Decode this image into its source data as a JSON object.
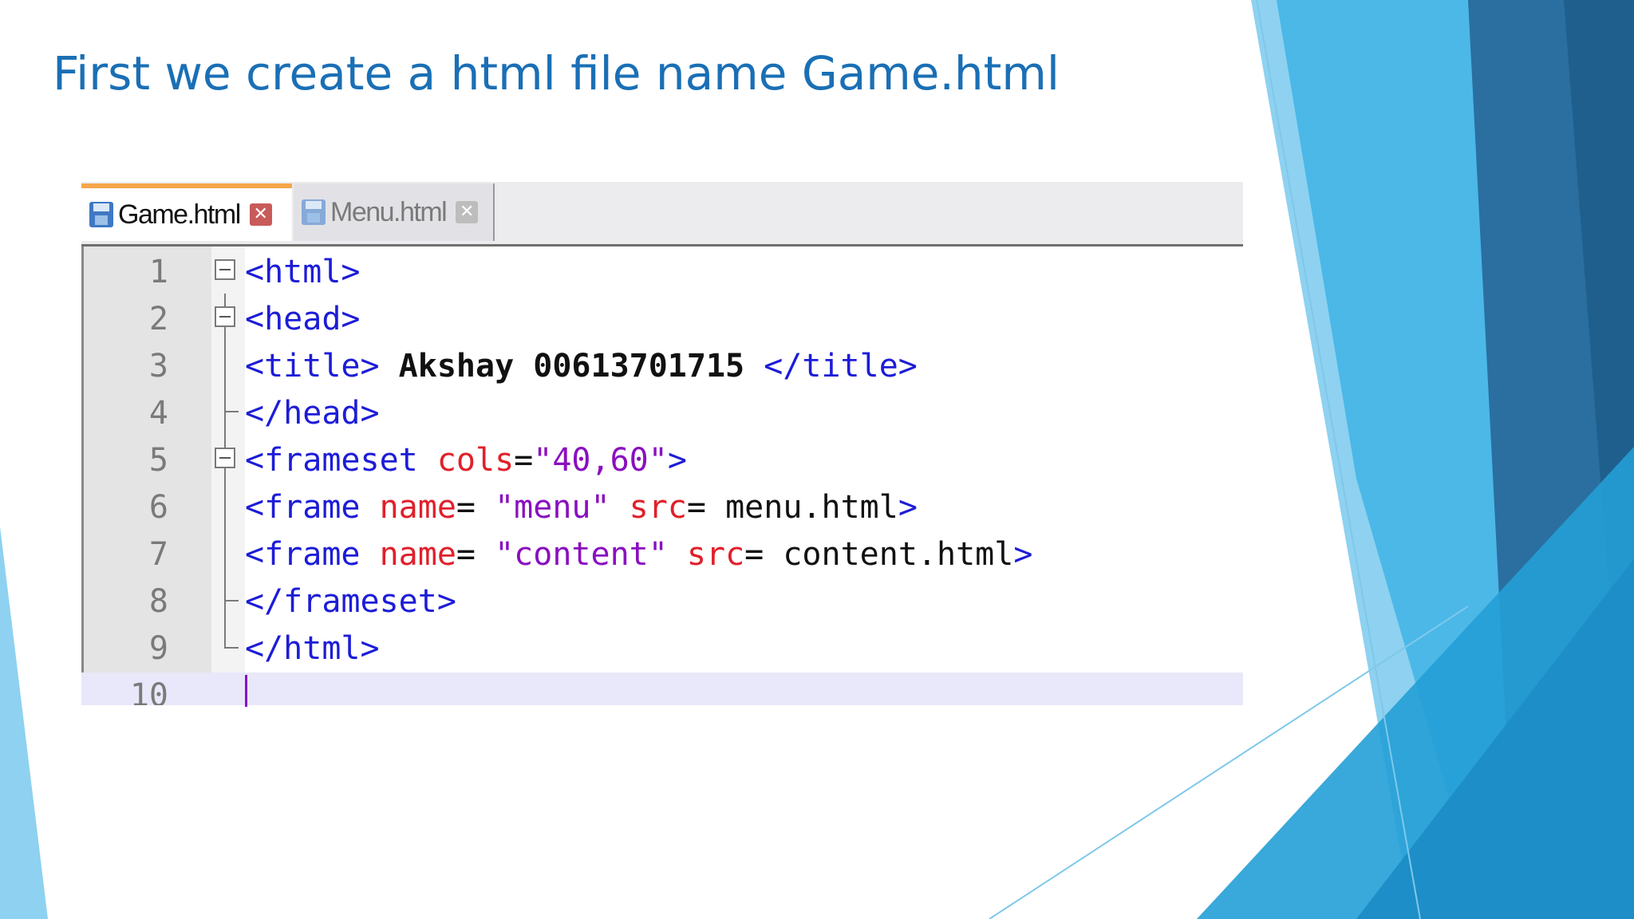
{
  "slide": {
    "title": "First we create a html file name Game.html"
  },
  "tabs": [
    {
      "label": "Game.html",
      "active": true,
      "icon": "save-icon",
      "close_icon": "close-icon"
    },
    {
      "label": "Menu.html",
      "active": false,
      "icon": "save-icon",
      "close_icon": "close-icon"
    }
  ],
  "editor": {
    "current_line": 10,
    "line_numbers": [
      "1",
      "2",
      "3",
      "4",
      "5",
      "6",
      "7",
      "8",
      "9",
      "10"
    ],
    "lines": [
      [
        {
          "t": "<html>",
          "k": "tag"
        }
      ],
      [
        {
          "t": "<head>",
          "k": "tag"
        }
      ],
      [
        {
          "t": "<title>",
          "k": "tag"
        },
        {
          "t": " Akshay 00613701715 ",
          "k": "txt-bold"
        },
        {
          "t": "</title>",
          "k": "tag"
        }
      ],
      [
        {
          "t": "</head>",
          "k": "tag"
        }
      ],
      [
        {
          "t": "<frameset ",
          "k": "tag"
        },
        {
          "t": "cols",
          "k": "attr"
        },
        {
          "t": "=",
          "k": "txt"
        },
        {
          "t": "\"40,60\"",
          "k": "str"
        },
        {
          "t": ">",
          "k": "tag"
        }
      ],
      [
        {
          "t": "<frame ",
          "k": "tag"
        },
        {
          "t": "name",
          "k": "attr"
        },
        {
          "t": "= ",
          "k": "txt"
        },
        {
          "t": "\"menu\"",
          "k": "str"
        },
        {
          "t": " ",
          "k": "txt"
        },
        {
          "t": "src",
          "k": "attr"
        },
        {
          "t": "= menu.html",
          "k": "txt"
        },
        {
          "t": ">",
          "k": "tag"
        }
      ],
      [
        {
          "t": "<frame ",
          "k": "tag"
        },
        {
          "t": "name",
          "k": "attr"
        },
        {
          "t": "= ",
          "k": "txt"
        },
        {
          "t": "\"content\"",
          "k": "str"
        },
        {
          "t": " ",
          "k": "txt"
        },
        {
          "t": "src",
          "k": "attr"
        },
        {
          "t": "= content.html",
          "k": "txt"
        },
        {
          "t": ">",
          "k": "tag"
        }
      ],
      [
        {
          "t": "</frameset>",
          "k": "tag"
        }
      ],
      [
        {
          "t": "</html>",
          "k": "tag"
        }
      ],
      []
    ]
  },
  "colors": {
    "title": "#1a6fb5",
    "tag": "#1c1cd8",
    "attribute": "#e0202a",
    "string": "#8a0fbf",
    "active_tab_accent": "#f5a64a"
  }
}
